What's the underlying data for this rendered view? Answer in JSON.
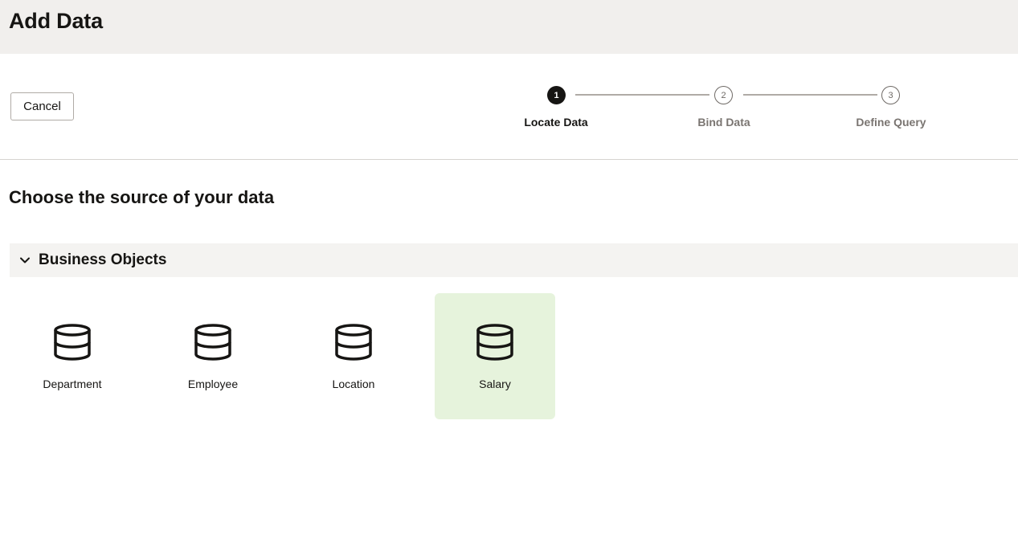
{
  "header": {
    "title": "Add Data"
  },
  "toolbar": {
    "cancel_label": "Cancel",
    "steps": [
      {
        "number": "1",
        "label": "Locate Data",
        "state": "active"
      },
      {
        "number": "2",
        "label": "Bind Data",
        "state": "pending"
      },
      {
        "number": "3",
        "label": "Define Query",
        "state": "pending"
      }
    ]
  },
  "main": {
    "title": "Choose the source of your data",
    "group": {
      "label": "Business Objects",
      "expanded": true,
      "items": [
        {
          "label": "Department",
          "icon": "database-icon",
          "selected": false
        },
        {
          "label": "Employee",
          "icon": "database-icon",
          "selected": false
        },
        {
          "label": "Location",
          "icon": "database-icon",
          "selected": false
        },
        {
          "label": "Salary",
          "icon": "database-icon",
          "selected": true
        }
      ]
    }
  },
  "colors": {
    "header_bg": "#f1efed",
    "selected_tile_bg": "#e6f3dc",
    "active_step": "#161513",
    "pending_step": "#6f6a66"
  }
}
